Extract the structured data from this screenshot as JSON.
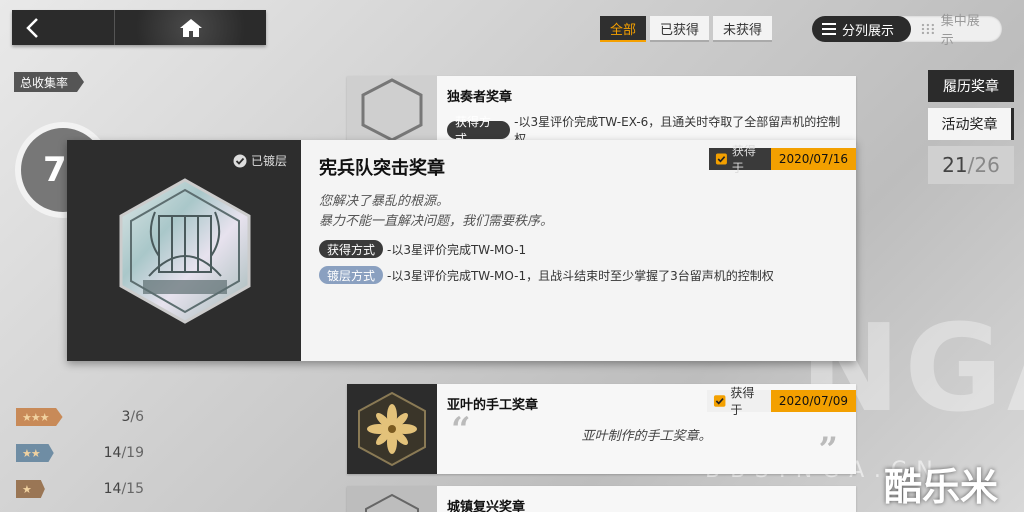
{
  "header": {
    "back_icon": "chevron-left-icon",
    "home_icon": "home-icon"
  },
  "filters": [
    "全部",
    "已获得",
    "未获得"
  ],
  "view_toggle": {
    "active": "分列展示",
    "inactive": "集中展示"
  },
  "stats": {
    "total_label": "总收集率",
    "ring_value": "7",
    "rows": [
      {
        "stars": "★★★",
        "count": "3",
        "total": "/6",
        "color": "#c88a58"
      },
      {
        "stars": "★★",
        "count": "14",
        "total": "/19",
        "color": "#6f8da4"
      },
      {
        "stars": "★",
        "count": "14",
        "total": "/15",
        "color": "#9a7655"
      }
    ]
  },
  "side_tabs": {
    "tab1": "履历奖章",
    "tab2": "活动奖章",
    "count_value": "21",
    "count_total": "/26"
  },
  "list": {
    "row1": {
      "title": "独奏者奖章",
      "method_label": "获得方式",
      "method_desc": "-以3星评价完成TW-EX-6，且通关时夺取了全部留声机的控制权"
    },
    "row2": {
      "title": "亚叶的手工奖章",
      "got_label": "获得于",
      "got_date": "2020/07/09",
      "quote": "亚叶制作的手工奖章。"
    },
    "row3": {
      "title": "城镇复兴奖章"
    }
  },
  "detail": {
    "gilded_label": "已镀层",
    "title": "宪兵队突击奖章",
    "got_label": "获得于",
    "got_date": "2020/07/16",
    "desc_line1": "您解决了暴乱的根源。",
    "desc_line2": "暴力不能一直解决问题，我们需要秩序。",
    "method_label": "获得方式",
    "method_desc": "-以3星评价完成TW-MO-1",
    "gild_label": "镀层方式",
    "gild_desc": "-以3星评价完成TW-MO-1，且战斗结束时至少掌握了3台留声机的控制权"
  },
  "watermark": {
    "big": "NGA",
    "url": "BBS.NGA.CN",
    "brand": "酷乐米"
  }
}
